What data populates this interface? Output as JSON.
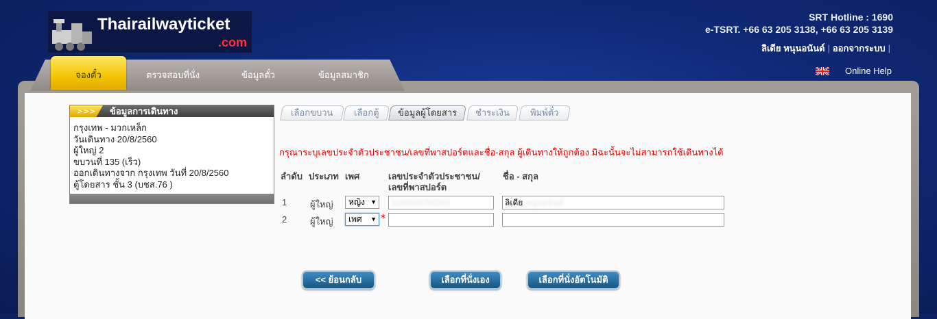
{
  "header": {
    "logo_text": "Thairailwayticket",
    "logo_suffix": ".com",
    "hotline": "SRT Hotline : 1690",
    "etsrt": "e-TSRT. +66 63 205 3138, +66 63 205 3139",
    "user_name": "ลิเดีย หนุนอนันต์",
    "logout": "ออกจากระบบ",
    "online_help": "Online Help"
  },
  "nav": {
    "items": [
      "จองตั๋ว",
      "ตรวจสอบที่นั่ง",
      "ข้อมูลตั๋ว",
      "ข้อมูลสมาชิก"
    ],
    "active_index": 0
  },
  "trip": {
    "title": "ข้อมูลการเดินทาง",
    "arrows": ">>>",
    "lines": [
      "กรุงเทพ - มวกเหล็ก",
      "วันเดินทาง 20/8/2560",
      "ผู้ใหญ่ 2",
      "ขบวนที่ 135 (เร็ว)",
      "ออกเดินทางจาก กรุงเทพ วันที่ 20/8/2560",
      "ตู้โดยสาร ชั้น 3 (บชส.76 )"
    ]
  },
  "steps": [
    "เลือกขบวน",
    "เลือกตู้",
    "ข้อมูลผู้โดยสาร",
    "ชำระเงิน",
    "พิมพ์ตั๋ว"
  ],
  "form": {
    "warning": "กรุณาระบุเลขประจำตัวประชาชน/เลขที่พาสปอร์ตและชื่อ-สกุล ผู้เดินทางให้ถูกต้อง มิฉะนั้นจะไม่สามารถใช้เดินทางได้",
    "headers": {
      "order": "ลำดับ",
      "type": "ประเภท",
      "gender": "เพศ",
      "id_line1": "เลขประจำตัวประชาชน/",
      "id_line2": "เลขที่พาสปอร์ต",
      "name": "ชื่อ - สกุล"
    },
    "rows": [
      {
        "no": "1",
        "type": "ผู้ใหญ่",
        "gender": "หญิง",
        "id": "1100500700260",
        "name_prefix": "ลิเดีย",
        "name_rest": "หนุนอนันต์"
      },
      {
        "no": "2",
        "type": "ผู้ใหญ่",
        "gender": "เพศ",
        "id": "",
        "name": "",
        "required_mark": "*"
      }
    ]
  },
  "buttons": {
    "back": "<< ย้อนกลับ",
    "select_self": "เลือกที่นั่งเอง",
    "select_auto": "เลือกที่นั่งอัตโนมัติ"
  }
}
